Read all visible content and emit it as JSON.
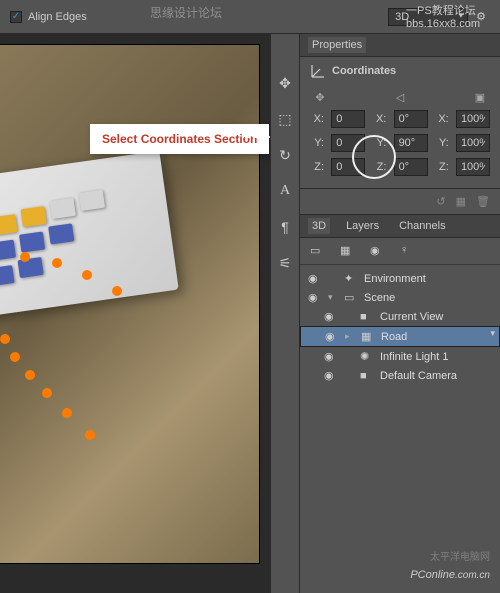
{
  "watermarks": {
    "top_center": "思缘设计论坛",
    "top_right_line1": "一PS教程论坛",
    "top_right_line2": "bbs.16xx8.com",
    "bottom_brand": "PConline",
    "bottom_brand_sub": ".com.cn",
    "bottom_cn": "太平洋电脑网"
  },
  "topbar": {
    "align_edges": "Align Edges",
    "mode": "3D"
  },
  "callout": "Select Coordinates Section",
  "properties": {
    "tab": "Properties",
    "section": "Coordinates",
    "rows": [
      {
        "axis": "X:",
        "pos": "0",
        "axis2": "X:",
        "rot": "0°",
        "axis3": "X:",
        "scale": "100%"
      },
      {
        "axis": "Y:",
        "pos": "0",
        "axis2": "Y:",
        "rot": "90°",
        "axis3": "Y:",
        "scale": "100%"
      },
      {
        "axis": "Z:",
        "pos": "0",
        "axis2": "Z:",
        "rot": "0°",
        "axis3": "Z:",
        "scale": "100%"
      }
    ]
  },
  "panel3d": {
    "tabs": [
      "3D",
      "Layers",
      "Channels"
    ],
    "items": [
      {
        "label": "Environment",
        "icon": "✦",
        "indent": 0
      },
      {
        "label": "Scene",
        "icon": "▭",
        "indent": 0,
        "expandable": true
      },
      {
        "label": "Current View",
        "icon": "■",
        "indent": 1
      },
      {
        "label": "Road",
        "icon": "▦",
        "indent": 1,
        "selected": true,
        "expandable": true
      },
      {
        "label": "Infinite Light 1",
        "icon": "✺",
        "indent": 1
      },
      {
        "label": "Default Camera",
        "icon": "■",
        "indent": 1
      }
    ]
  }
}
